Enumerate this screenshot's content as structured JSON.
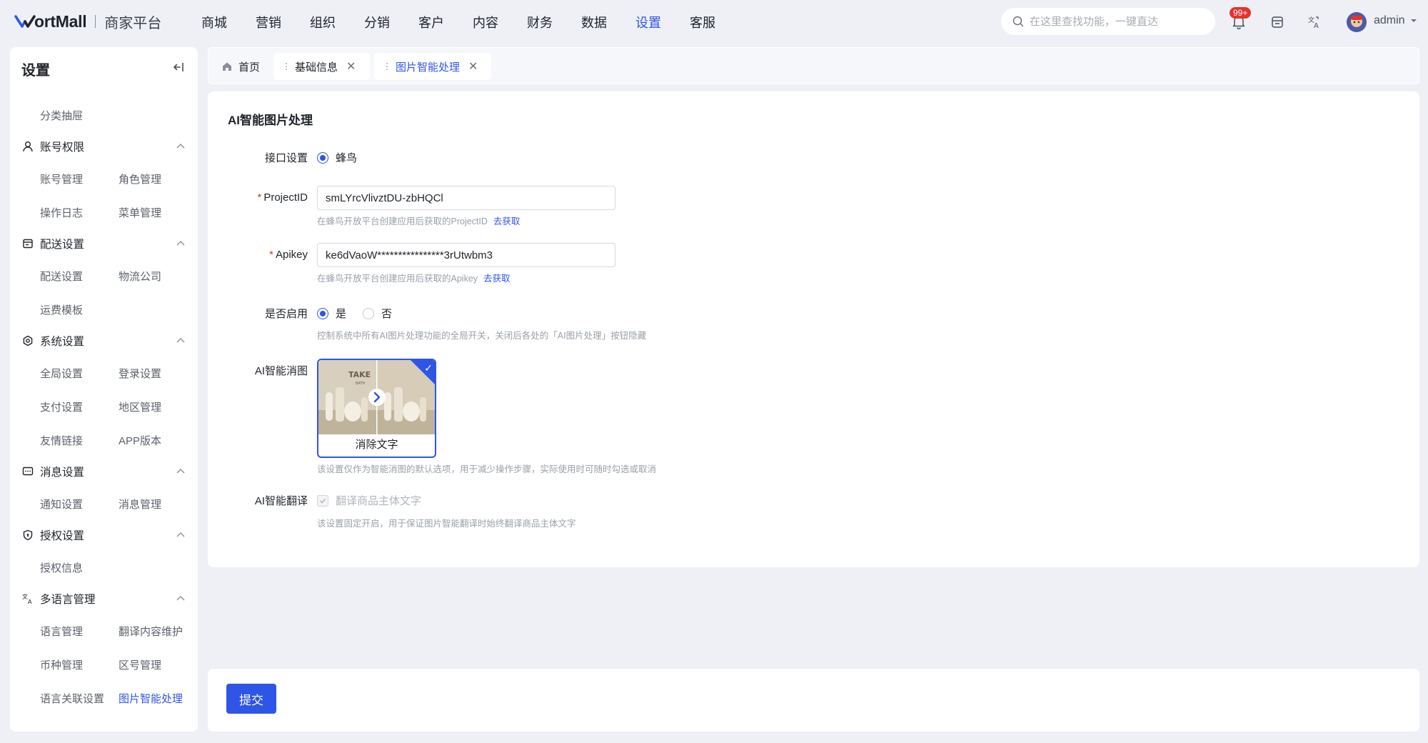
{
  "header": {
    "logo_text": "ortMall",
    "logo_sub": "商家平台",
    "nav": [
      "商城",
      "营销",
      "组织",
      "分销",
      "客户",
      "内容",
      "财务",
      "数据",
      "设置",
      "客服"
    ],
    "nav_active": "设置",
    "search_placeholder": "在这里查找功能，一键直达",
    "notification_badge": "99+",
    "username": "admin"
  },
  "sidebar": {
    "title": "设置",
    "loose_items": [
      "分类抽屉"
    ],
    "groups": [
      {
        "label": "账号权限",
        "items": [
          "账号管理",
          "角色管理",
          "操作日志",
          "菜单管理"
        ]
      },
      {
        "label": "配送设置",
        "items": [
          "配送设置",
          "物流公司",
          "运费模板"
        ]
      },
      {
        "label": "系统设置",
        "items": [
          "全局设置",
          "登录设置",
          "支付设置",
          "地区管理",
          "友情链接",
          "APP版本"
        ]
      },
      {
        "label": "消息设置",
        "items": [
          "通知设置",
          "消息管理"
        ]
      },
      {
        "label": "授权设置",
        "items": [
          "授权信息"
        ]
      },
      {
        "label": "多语言管理",
        "items": [
          "语言管理",
          "翻译内容维护",
          "币种管理",
          "区号管理",
          "语言关联设置",
          "图片智能处理"
        ]
      }
    ],
    "active_item": "图片智能处理"
  },
  "tabs": [
    {
      "label": "首页"
    },
    {
      "label": "基础信息"
    },
    {
      "label": "图片智能处理"
    }
  ],
  "form": {
    "section_title": "AI智能图片处理",
    "interface": {
      "label": "接口设置",
      "option": "蜂鸟"
    },
    "project_id": {
      "label": "ProjectID",
      "value": "smLYrcVlivztDU-zbHQCl",
      "hint": "在蜂鸟开放平台创建应用后获取的ProjectID",
      "link": "去获取"
    },
    "apikey": {
      "label": "Apikey",
      "value": "ke6dVaoW****************3rUtwbm3",
      "hint": "在蜂鸟开放平台创建应用后获取的Apikey",
      "link": "去获取"
    },
    "enable": {
      "label": "是否启用",
      "yes": "是",
      "no": "否",
      "hint": "控制系统中所有AI图片处理功能的全局开关，关闭后各处的「AI图片处理」按钮隐藏"
    },
    "erase": {
      "label": "AI智能消图",
      "card_label": "消除文字",
      "card_image_text": "TAKE",
      "card_image_subtext": "BATH",
      "hint": "该设置仅作为智能消图的默认选项，用于减少操作步骤，实际使用时可随时勾选或取消"
    },
    "translate": {
      "label": "AI智能翻译",
      "checkbox": "翻译商品主体文字",
      "hint": "该设置固定开启，用于保证图片智能翻译时始终翻译商品主体文字"
    }
  },
  "footer": {
    "submit": "提交"
  },
  "colors": {
    "accent": "#2f55e6",
    "required": "#e5322d",
    "badge": "#e5322d"
  }
}
